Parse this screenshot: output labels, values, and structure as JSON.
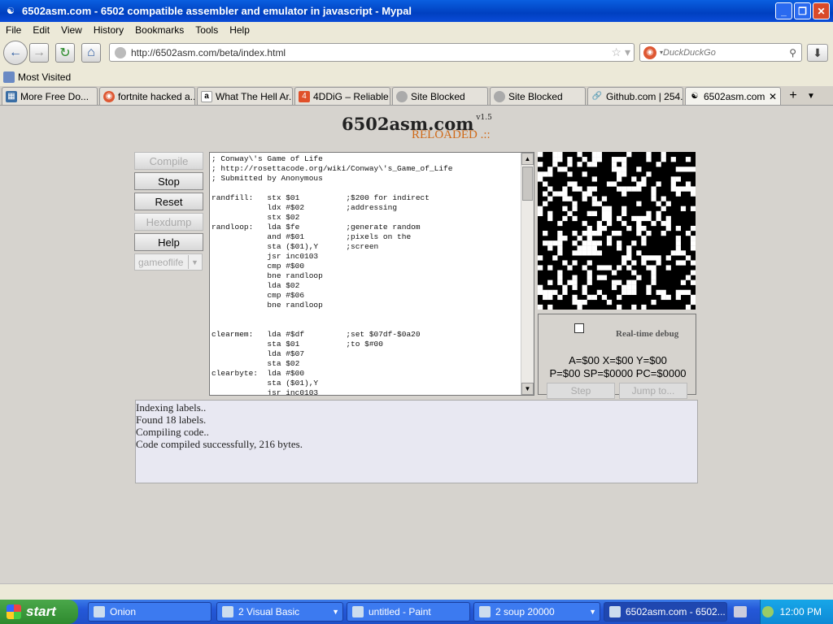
{
  "window": {
    "title": "6502asm.com - 6502 compatible assembler and emulator in javascript - Mypal",
    "minimize": "_",
    "restore": "❐",
    "close": "✕"
  },
  "menu": [
    "File",
    "Edit",
    "View",
    "History",
    "Bookmarks",
    "Tools",
    "Help"
  ],
  "nav": {
    "url": "http://6502asm.com/beta/index.html",
    "search_placeholder": "DuckDuckGo"
  },
  "bookmarks": {
    "most_visited": "Most Visited"
  },
  "tabs": [
    {
      "label": "More Free Do...",
      "icon": "grid-icon",
      "color": "#3a6ea5"
    },
    {
      "label": "fortnite hacked a...",
      "icon": "duckduckgo-icon",
      "color": "#de5833"
    },
    {
      "label": "What The Hell Ar...",
      "icon": "amazon-icon",
      "color": "#222222"
    },
    {
      "label": "4DDiG – Reliable ...",
      "icon": "4ddig-icon",
      "color": "#e0502a"
    },
    {
      "label": "Site Blocked",
      "icon": "globe-icon",
      "color": "#888888"
    },
    {
      "label": "Site Blocked",
      "icon": "globe-icon",
      "color": "#888888"
    },
    {
      "label": "Github.com | 254...",
      "icon": "link-icon",
      "color": "#888888"
    },
    {
      "label": "6502asm.com...",
      "icon": "mypal-icon",
      "color": "#666666",
      "active": true
    }
  ],
  "app": {
    "logo": "6502asm.com",
    "version": "v1.5",
    "reloaded": "RELOADED .::",
    "buttons": {
      "compile": "Compile",
      "stop": "Stop",
      "reset": "Reset",
      "hexdump": "Hexdump",
      "help": "Help"
    },
    "select_value": "gameoflife",
    "code_lines": [
      "; Conway\\'s Game of Life",
      "; http://rosettacode.org/wiki/Conway\\'s_Game_of_Life",
      "; Submitted by Anonymous",
      "",
      "randfill:   stx $01          ;$200 for indirect",
      "            ldx #$02         ;addressing",
      "            stx $02",
      "randloop:   lda $fe          ;generate random",
      "            and #$01         ;pixels on the",
      "            sta ($01),Y      ;screen",
      "            jsr inc0103",
      "            cmp #$00",
      "            bne randloop",
      "            lda $02",
      "            cmp #$06",
      "            bne randloop",
      "",
      "",
      "clearmem:   lda #$df         ;set $07df-$0a20",
      "            sta $01          ;to $#00",
      "            lda #$07",
      "            sta $02",
      "clearbyte:  lda #$00",
      "            sta ($01),Y",
      "            jsr inc0103"
    ],
    "debug": {
      "label": "Real-time debug",
      "regs1": "A=$00 X=$00 Y=$00",
      "regs2": "P=$00 SP=$0000 PC=$0000",
      "step": "Step",
      "jump": "Jump to..."
    },
    "console": [
      "Indexing labels..",
      "Found 18 labels.",
      "Compiling code..",
      "Code compiled successfully, 216 bytes."
    ]
  },
  "taskbar": {
    "start": "start",
    "items": [
      {
        "label": "Onion"
      },
      {
        "label": "2 Visual Basic"
      },
      {
        "label": "untitled - Paint"
      },
      {
        "label": "2 soup 20000"
      },
      {
        "label": "6502asm.com - 6502..."
      }
    ],
    "clock": "12:00 PM"
  },
  "colors": {
    "logo_accent": "#d06a18",
    "titlebar": "#0a5fe0",
    "console_bg": "#e8e8f2"
  }
}
